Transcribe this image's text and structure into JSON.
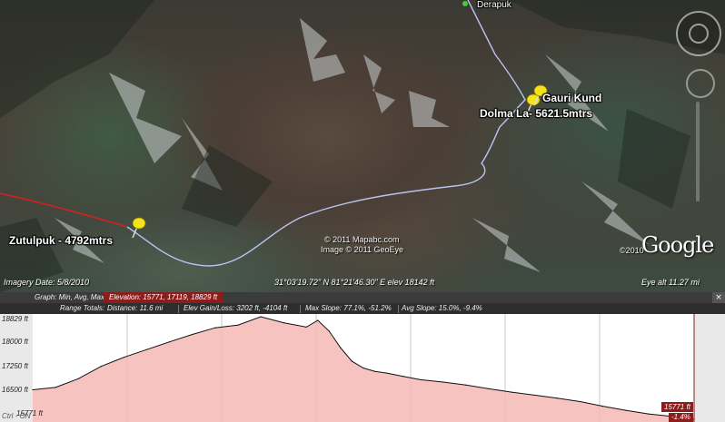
{
  "map": {
    "places": {
      "derapuk": "Derapuk",
      "gauri_kund": "Gauri Kund",
      "dolma_la": "Dolma La- 5621.5mtrs",
      "zutulpuk": "Zutulpuk - 4792mtrs"
    },
    "copyright_lines": [
      "© 2011 Mapabc.com",
      "Image © 2011 GeoEye"
    ],
    "logo_year": "©2010",
    "logo": "Google",
    "imagery_date": "Imagery Date: 5/8/2010",
    "coordinates": "31°03'19.72\" N   81°21'46.30\" E  elev 18142 ft",
    "eye_alt": "Eye alt   11.27 mi",
    "icons": {
      "pin": "yellow-pushpin-icon",
      "compass": "navigation-ring-icon"
    },
    "colors": {
      "route": "#b9c3f0",
      "previous_route": "#d42020",
      "pin": "#f4e21a"
    }
  },
  "elevation": {
    "header": {
      "graph_label": "Graph: Min, Avg, Max",
      "elevation_stats": "Elevation: 15771, 17119, 18829 ft",
      "range_label": "Range Totals:",
      "distance": "Distance: 11.6 mi",
      "gain_loss": "Elev Gain/Loss: 3202 ft, -4104 ft",
      "max_slope": "Max Slope: 77.1%, -51.2%",
      "avg_slope": "Avg Slope: 15.0%, -9.4%",
      "close": "×"
    },
    "y_ticks": [
      "18829 ft",
      "18000 ft",
      "17250 ft",
      "16500 ft",
      "15771 ft"
    ],
    "end_value": "15771 ft",
    "end_slope": "-1.4%",
    "bottom_note": "Ctrl - ON",
    "colors": {
      "fill": "#f4b8b5",
      "line": "#111111",
      "highlight": "#8b1d1d"
    }
  },
  "chart_data": {
    "type": "area",
    "title": "",
    "xlabel": "",
    "ylabel": "",
    "y_unit": "ft",
    "x_unit": "mi",
    "ylim": [
      15771,
      18829
    ],
    "xlim": [
      0,
      11.6
    ],
    "grid": true,
    "series": [
      {
        "x": [
          0,
          0.4,
          0.8,
          1.2,
          1.6,
          2.0,
          2.4,
          2.8,
          3.2,
          3.6,
          4.0,
          4.4,
          4.8,
          5.0,
          5.2,
          5.4,
          5.6,
          5.8,
          6.0,
          6.2,
          6.5,
          6.8,
          7.2,
          7.6,
          8.0,
          8.4,
          8.8,
          9.2,
          9.6,
          10.0,
          10.4,
          10.8,
          11.2,
          11.6
        ],
        "y": [
          16650,
          16720,
          16980,
          17350,
          17620,
          17850,
          18080,
          18300,
          18500,
          18580,
          18829,
          18650,
          18520,
          18720,
          18400,
          17900,
          17500,
          17300,
          17200,
          17150,
          17050,
          16950,
          16880,
          16790,
          16680,
          16580,
          16490,
          16400,
          16300,
          16160,
          16040,
          15930,
          15860,
          15771
        ]
      }
    ]
  }
}
